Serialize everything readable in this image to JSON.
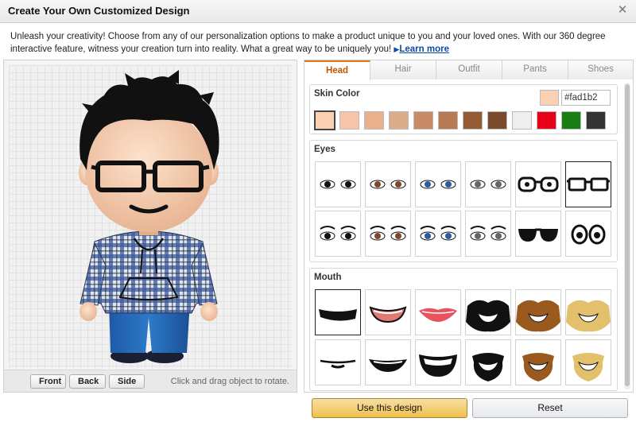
{
  "window": {
    "title": "Create Your Own Customized Design",
    "close_icon": "close-icon"
  },
  "intro": {
    "text": "Unleash your creativity! Choose from any of our personalization options to make a product unique to you and your loved ones. With our 360 degree interactive feature, witness your creation turn into reality. What a great way to be uniquely you!",
    "link_label": "Learn more"
  },
  "preview": {
    "buttons": {
      "front": "Front",
      "back": "Back",
      "side": "Side"
    },
    "hint": "Click and drag object to rotate."
  },
  "tabs": [
    {
      "label": "Head",
      "active": true
    },
    {
      "label": "Hair",
      "active": false
    },
    {
      "label": "Outfit",
      "active": false
    },
    {
      "label": "Pants",
      "active": false
    },
    {
      "label": "Shoes",
      "active": false
    }
  ],
  "skin": {
    "title": "Skin Color",
    "hex_value": "#fad1b2",
    "current_color": "#fad1b2",
    "swatches": [
      "#fad1b2",
      "#f6c4aa",
      "#eab08c",
      "#dcad8a",
      "#c98a68",
      "#b77a52",
      "#955b33",
      "#7a4a2c",
      "#eeeeee",
      "#e8001a",
      "#177e14",
      "#333333"
    ],
    "selected_index": 0
  },
  "eyes": {
    "title": "Eyes",
    "selected_index": 5,
    "icon_names": [
      "eyes-black-icon",
      "eyes-brown-icon",
      "eyes-blue-icon",
      "eyes-gray-icon",
      "round-glasses-icon",
      "square-glasses-icon",
      "eyes-lashes-black-icon",
      "eyes-lashes-brown-icon",
      "eyes-lashes-blue-icon",
      "eyes-lashes-gray-icon",
      "sunglasses-icon",
      "googly-eyes-icon"
    ]
  },
  "mouth": {
    "title": "Mouth",
    "selected_index": 0,
    "icon_names": [
      "mouth-smile-black-icon",
      "mouth-grin-pink-icon",
      "mouth-lips-red-icon",
      "beard-black-icon",
      "beard-brown-icon",
      "beard-blonde-icon",
      "mouth-mustache-icon",
      "mouth-open-smile-icon",
      "mouth-big-grin-icon",
      "goatee-black-icon",
      "goatee-brown-icon",
      "goatee-blonde-icon"
    ]
  },
  "actions": {
    "use": "Use this design",
    "reset": "Reset"
  }
}
